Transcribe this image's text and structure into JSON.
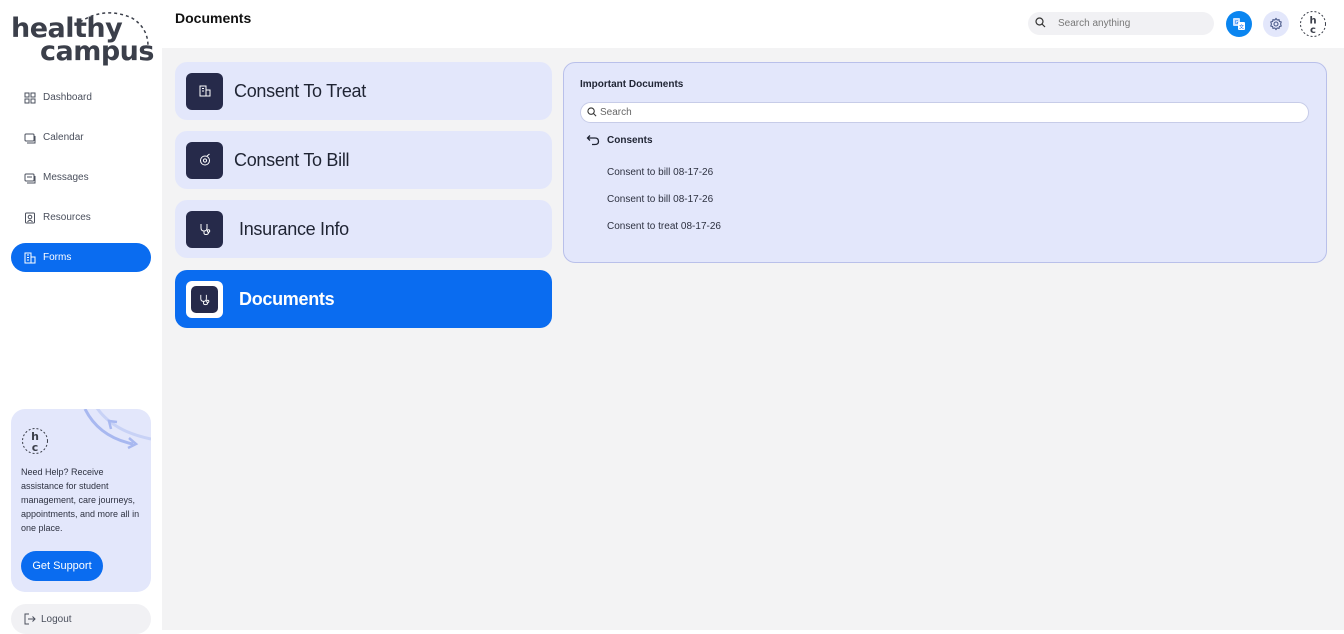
{
  "app": {
    "logo_line1": "healthy",
    "logo_line2": "campus",
    "logo_monogram": "hc"
  },
  "header": {
    "title": "Documents",
    "search_placeholder": "Search anything",
    "icons": [
      "search-icon",
      "translate-icon",
      "gear-icon",
      "avatar"
    ]
  },
  "sidebar": {
    "items": [
      {
        "label": "Dashboard",
        "icon": "grid-icon",
        "active": false
      },
      {
        "label": "Calendar",
        "icon": "calendar-icon",
        "active": false
      },
      {
        "label": "Messages",
        "icon": "chat-icon",
        "active": false
      },
      {
        "label": "Resources",
        "icon": "resources-icon",
        "active": false
      },
      {
        "label": "Forms",
        "icon": "forms-icon",
        "active": true
      }
    ],
    "help": {
      "text": "Need Help? Receive assistance for student management, care journeys, appointments, and more all in one place.",
      "button": "Get Support"
    },
    "logout": "Logout"
  },
  "forms": [
    {
      "label": "Consent To Treat",
      "icon": "building-icon",
      "active": false
    },
    {
      "label": "Consent To Bill",
      "icon": "billing-icon",
      "active": false
    },
    {
      "label": "Insurance Info",
      "icon": "stethoscope-icon",
      "active": false
    },
    {
      "label": "Documents",
      "icon": "stethoscope-icon",
      "active": true
    }
  ],
  "documents_panel": {
    "title": "Important Documents",
    "search_placeholder": "Search",
    "folder": "Consents",
    "items": [
      "Consent to bill 08-17-26",
      "Consent to bill 08-17-26",
      "Consent to treat 08-17-26"
    ]
  },
  "colors": {
    "accent": "#0a6cf0",
    "card_bg": "#e3e7fb",
    "tile_dark": "#262a4a",
    "main_bg": "#f3f3f4"
  }
}
